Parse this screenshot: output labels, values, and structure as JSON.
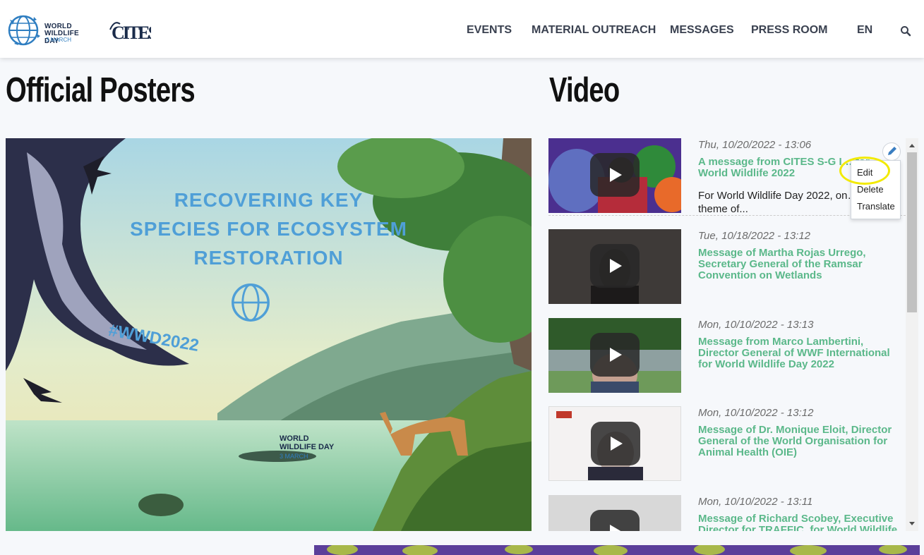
{
  "header": {
    "logo_wwd": {
      "line1": "WORLD",
      "line2": "WILDLIFE DAY",
      "line3": "3 MARCH"
    },
    "logo_cites": "CITES",
    "nav": [
      "EVENTS",
      "MATERIAL OUTREACH",
      "MESSAGES",
      "PRESS ROOM"
    ],
    "language": "EN",
    "search_icon": "search-icon"
  },
  "posters": {
    "heading": "Official Posters",
    "poster_text": {
      "line1": "RECOVERING KEY",
      "line2": "SPECIES FOR ECOSYSTEM",
      "line3": "RESTORATION",
      "hashtag": "#WWD2022",
      "logo_line1": "WORLD",
      "logo_line2": "WILDLIFE DAY",
      "logo_line3": "3 MARCH"
    }
  },
  "video": {
    "heading": "Video",
    "items": [
      {
        "date": "Thu, 10/20/2022 - 13:06",
        "title": "A message from CITES S-G I… for World Wildlife 2022",
        "desc": "For World Wildlife Day 2022, on… theme of..."
      },
      {
        "date": "Tue, 10/18/2022 - 13:12",
        "title": "Message of Martha Rojas Urrego, Secretary General of the Ramsar Convention on Wetlands",
        "desc": ""
      },
      {
        "date": "Mon, 10/10/2022 - 13:13",
        "title": "Message from Marco Lambertini, Director General of WWF International for World Wildlife Day 2022",
        "desc": ""
      },
      {
        "date": "Mon, 10/10/2022 - 13:12",
        "title": "Message of Dr. Monique Eloit, Director General of the World Organisation for Animal Health (OIE)",
        "desc": ""
      },
      {
        "date": "Mon, 10/10/2022 - 13:11",
        "title": "Message of Richard Scobey, Executive Director for TRAFFIC, for World Wildlife",
        "desc": ""
      }
    ]
  },
  "context_menu": {
    "pencil_icon": "pencil-icon",
    "items": [
      "Edit",
      "Delete",
      "Translate"
    ]
  },
  "colors": {
    "accent_green": "#5bb88a",
    "nav_text": "#3a4150",
    "highlight": "#f2ea00"
  }
}
